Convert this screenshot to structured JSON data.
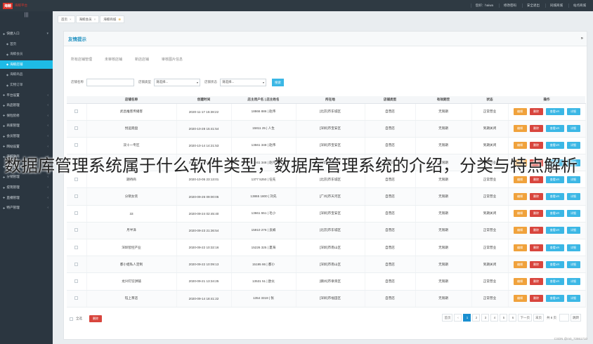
{
  "app": {
    "logo_mark": "海鲸",
    "logo_text": "海鲸平台",
    "top_nav": [
      "您好：haiwa",
      "修改密码",
      "安全退出",
      "同城商城",
      "站点商城"
    ]
  },
  "sidebar": {
    "toggle": "|||",
    "items": [
      {
        "label": "快捷入口",
        "level": 0,
        "active": false,
        "arrow": "▾"
      },
      {
        "label": "首页",
        "level": 1,
        "active": false,
        "arrow": ""
      },
      {
        "label": "海鲸会员",
        "level": 1,
        "active": false,
        "arrow": ""
      },
      {
        "label": "海鲸店铺",
        "level": 1,
        "active": true,
        "arrow": ""
      },
      {
        "label": "海鲸商品",
        "level": 1,
        "active": false,
        "arrow": ""
      },
      {
        "label": "实物订单",
        "level": 1,
        "active": false,
        "arrow": ""
      },
      {
        "label": "平台设置",
        "level": 0,
        "active": false,
        "arrow": "‹"
      },
      {
        "label": "商品管理",
        "level": 0,
        "active": false,
        "arrow": "‹"
      },
      {
        "label": "保险装修",
        "level": 0,
        "active": false,
        "arrow": "‹"
      },
      {
        "label": "商家管理",
        "level": 0,
        "active": false,
        "arrow": "‹"
      },
      {
        "label": "会员管理",
        "level": 0,
        "active": false,
        "arrow": "‹"
      },
      {
        "label": "网站设置",
        "level": 0,
        "active": false,
        "arrow": "‹"
      },
      {
        "label": "海鲸微商",
        "level": 0,
        "active": false,
        "arrow": "‹"
      },
      {
        "label": "海鲸工具箱",
        "level": 0,
        "active": false,
        "arrow": "‹"
      },
      {
        "label": "分销管理",
        "level": 0,
        "active": false,
        "arrow": "‹"
      },
      {
        "label": "提现管理",
        "level": 0,
        "active": false,
        "arrow": "‹"
      },
      {
        "label": "直播管理",
        "level": 0,
        "active": false,
        "arrow": "‹"
      },
      {
        "label": "特产管理",
        "level": 0,
        "active": false,
        "arrow": "‹"
      }
    ]
  },
  "tabs": [
    {
      "label": "首页",
      "x": "×"
    },
    {
      "label": "海鲸会员",
      "x": "×"
    },
    {
      "label": "海鲸商城",
      "x": "⊗"
    }
  ],
  "panel": {
    "title": "友情提示",
    "chevron": "»",
    "subtabs": [
      "所有店铺管理",
      "未审核店铺",
      "新店店铺",
      "审核图片信息"
    ]
  },
  "filter": {
    "name_label": "店铺名称",
    "type_label": "店铺类型",
    "type_value": "请选择...",
    "status_label": "店铺状态",
    "status_value": "请选择...",
    "search": "搜索"
  },
  "table": {
    "headers": [
      "",
      "店铺名称",
      "创建时间",
      "店主用户名 | 店主姓名",
      "所在地",
      "店铺类型",
      "有效期至",
      "状态",
      "操作"
    ],
    "ops": {
      "edit": "编辑",
      "delete": "删除",
      "vr": "查看VR",
      "up": "详细"
    },
    "rows": [
      {
        "name": "武昌推客传播客",
        "time": "2020-11-17 15:38:22",
        "owner": "18866 886 | 赵伟",
        "loc": "[北京]市东城区",
        "type": "自营店",
        "expire": "无限期",
        "status": "正常营业"
      },
      {
        "name": "悦运跑盘",
        "time": "2020-10-28 15:41:54",
        "owner": "15811 25 | 人生",
        "loc": "[深圳]市宝安区",
        "type": "自营店",
        "expire": "无限期",
        "status": "到期关闭"
      },
      {
        "name": "双十一专区",
        "time": "2020-10-14 14:21:53",
        "owner": "13561 348 | 赵伟",
        "loc": "[深圳]市宝安区",
        "type": "自营店",
        "expire": "无限期",
        "status": "到期关闭"
      },
      {
        "name": "仿真装修",
        "time": "2020-10-13 10:44:22",
        "owner": "13561 348 | 赵伟",
        "loc": "[深圳]市宝安区",
        "type": "自营店",
        "expire": "无限期",
        "status": "正常营业"
      },
      {
        "name": "期待商",
        "time": "2020-10-05 23:13:01",
        "owner": "1377 5250 | 任先",
        "loc": "[北京]市东城区",
        "type": "自营店",
        "expire": "无限期",
        "status": "正常营业"
      },
      {
        "name": "分销女装",
        "time": "2020-09-26 09:00:05",
        "owner": "13865 1800 | 刘先",
        "loc": "[广州]市天河区",
        "type": "自营店",
        "expire": "无限期",
        "status": "正常营业"
      },
      {
        "name": "33",
        "time": "2020-09-24 02:45:40",
        "owner": "13661 551 | 毛小",
        "loc": "[深圳]市宝安区",
        "type": "自营店",
        "expire": "无限期",
        "status": "到期关闭"
      },
      {
        "name": "月半泽",
        "time": "2020-09-23 21:36:54",
        "owner": "15910 276 | 良姆",
        "loc": "[北京]市东城区",
        "type": "自营店",
        "expire": "无限期",
        "status": "正常营业"
      },
      {
        "name": "深圳智控产业",
        "time": "2020-09-22 10:32:16",
        "owner": "15226 325 | 夏海",
        "loc": "[深圳]市南山区",
        "type": "自营店",
        "expire": "无限期",
        "status": "正常营业"
      },
      {
        "name": "都小姐私人定制",
        "time": "2020-09-22 10:09:13",
        "owner": "15195 86 | 都小",
        "loc": "[深圳]市南山区",
        "type": "自营店",
        "expire": "无限期",
        "status": "到期关闭"
      },
      {
        "name": "龙兴钉饺饼铺",
        "time": "2020-09-21 13:34:25",
        "owner": "13531 51 | 欧炎",
        "loc": "[赣州]市章贡区",
        "type": "自营店",
        "expire": "无限期",
        "status": "正常营业"
      },
      {
        "name": "钰上茶店",
        "time": "2020-09-14 18:41:22",
        "owner": "1354 3319 | 张",
        "loc": "[深圳]市福田区",
        "type": "自营店",
        "expire": "无限期",
        "status": "正常营业"
      }
    ]
  },
  "footer": {
    "select_all": "全选",
    "delete": "删除",
    "pager": {
      "first": "首页",
      "prev": "‹",
      "pages": [
        "1",
        "2",
        "3",
        "4",
        "5",
        "6"
      ],
      "current": "1",
      "next": "下一页",
      "last": "末页",
      "total": "共 8 页",
      "goto": "跳转"
    }
  },
  "overlay_text": "数据库管理系统属于什么软件类型，数据库管理系统的介绍，分类与特点解析",
  "watermark": "CSDN @m0_72861710"
}
